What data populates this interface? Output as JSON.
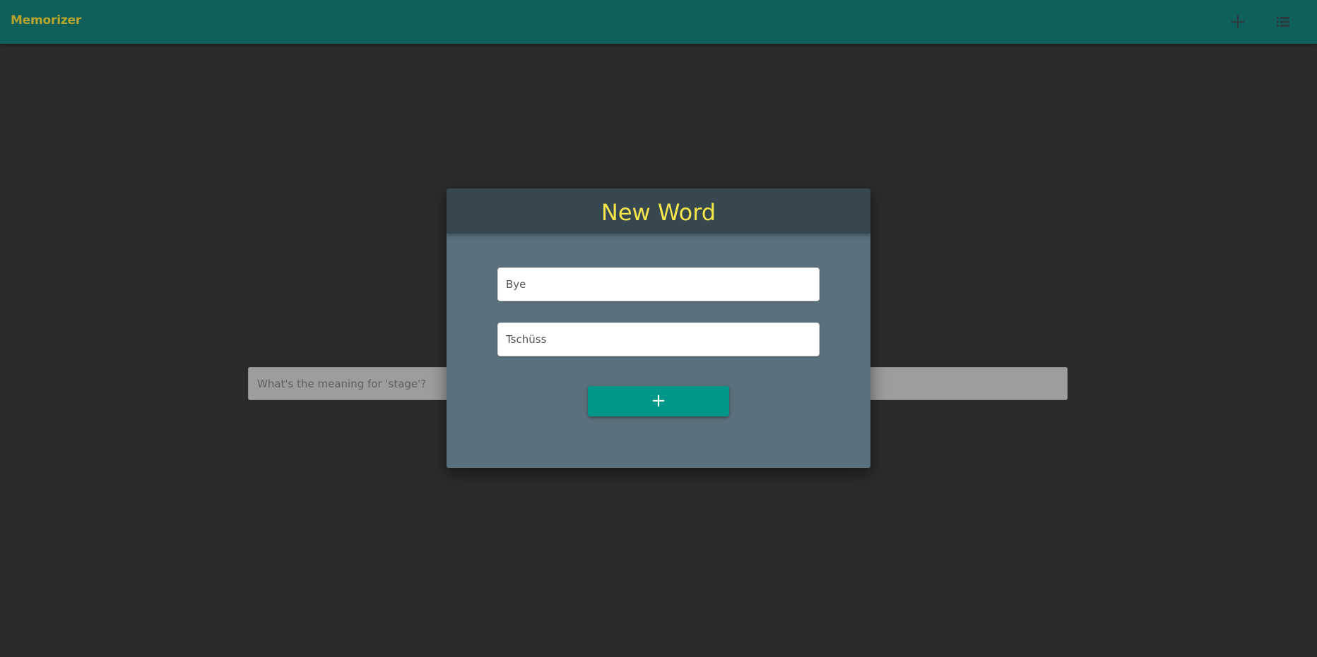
{
  "app_bar": {
    "title": "Memorizer",
    "actions": [
      {
        "icon": "plus-icon",
        "label": "Add word"
      },
      {
        "icon": "list-icon",
        "label": "Word list"
      }
    ],
    "colors": {
      "background": "#0f5f5a",
      "title": "#b8a62e"
    }
  },
  "main": {
    "quiz_input": {
      "placeholder": "What's the meaning for 'stage'?",
      "value": ""
    }
  },
  "modal": {
    "title": "New Word",
    "word_field": {
      "value": "Bye"
    },
    "translation_field": {
      "value": "Tschüss"
    },
    "add_button": {
      "label": "+"
    },
    "colors": {
      "header": "#36474f",
      "body": "#5a707c",
      "title": "#f4e64a",
      "button": "#009688"
    }
  }
}
